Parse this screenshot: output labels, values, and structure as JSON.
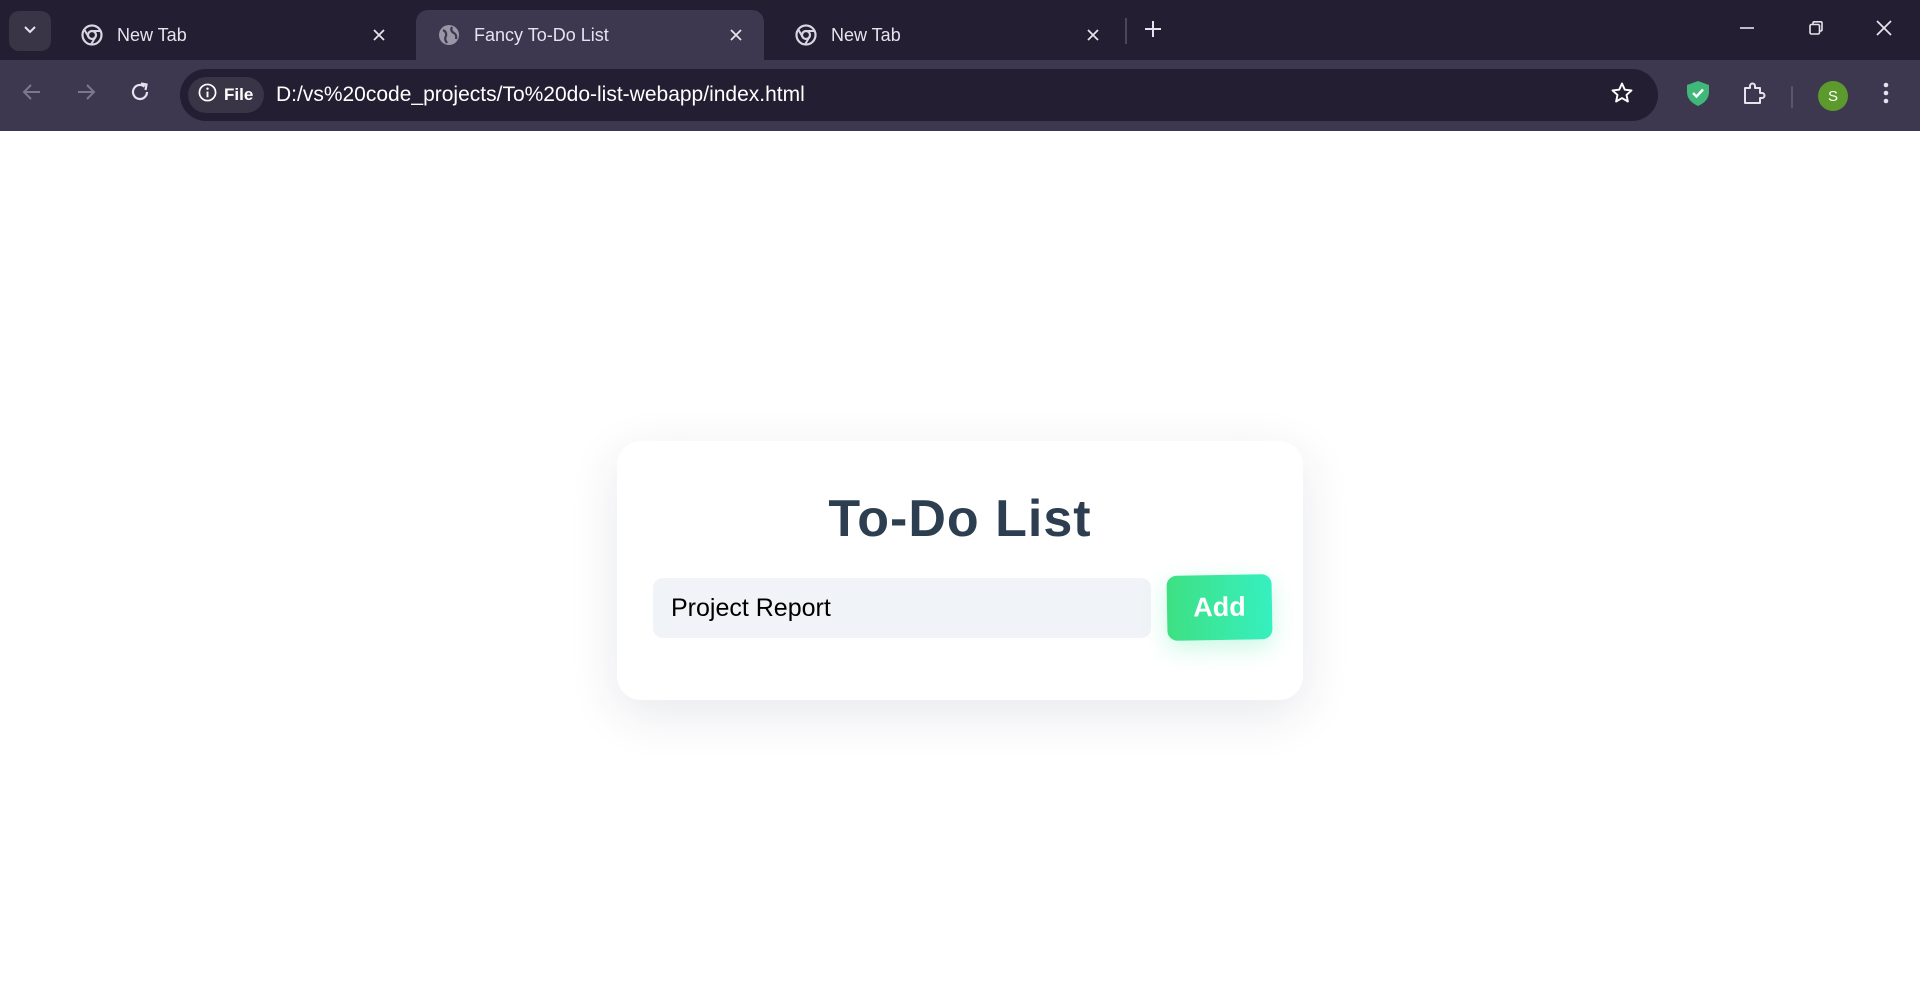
{
  "browser": {
    "tabs": [
      {
        "label": "New Tab",
        "favicon": "chrome-icon",
        "active": false
      },
      {
        "label": "Fancy To-Do List",
        "favicon": "globe-icon",
        "active": true
      },
      {
        "label": "New Tab",
        "favicon": "chrome-icon",
        "active": false
      }
    ],
    "address": {
      "chip_label": "File",
      "url": "D:/vs%20code_projects/To%20do-list-webapp/index.html"
    },
    "profile_initial": "S",
    "colors": {
      "tabbar_bg": "#231e31",
      "toolbar_bg": "#3d3750",
      "shield_green": "#3fb87a",
      "avatar_green": "#5c9a2e"
    }
  },
  "app": {
    "title": "To-Do List",
    "task_input": {
      "value": "Project Report",
      "placeholder": ""
    },
    "add_label": "Add",
    "colors": {
      "title": "#2c3e50",
      "input_bg": "#f0f3f7",
      "button_gradient_start": "#3ee083",
      "button_gradient_end": "#36f0c0"
    }
  }
}
